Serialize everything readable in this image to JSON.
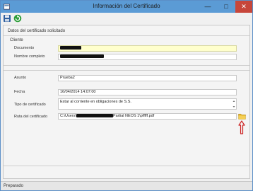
{
  "window": {
    "title": "Información del Certificado"
  },
  "toolbar": {
    "save_icon": "save-icon",
    "refresh_icon": "refresh-icon"
  },
  "section": {
    "title": "Datos del certificado solicitado"
  },
  "cliente": {
    "group_label": "Cliente",
    "documento_label": "Documento",
    "nombre_label": "Nombre completo"
  },
  "details": {
    "asunto_label": "Asunto",
    "asunto_value": "Prueba2",
    "fecha_label": "Fecha",
    "fecha_value": "16/04/2014 14:07:00",
    "tipo_label": "Tipo de certificado",
    "tipo_value": "Estar al corriente en obligaciones de S.S.",
    "ruta_label": "Ruta del certificado",
    "ruta_prefix": "C:\\Users\\",
    "ruta_suffix": "Partial NEOS 1\\pfffff.pdf"
  },
  "status": {
    "text": "Preparado"
  },
  "colors": {
    "titlebar": "#5b9bd5",
    "highlight_field": "#ffffcc",
    "arrow": "#cc2222"
  }
}
